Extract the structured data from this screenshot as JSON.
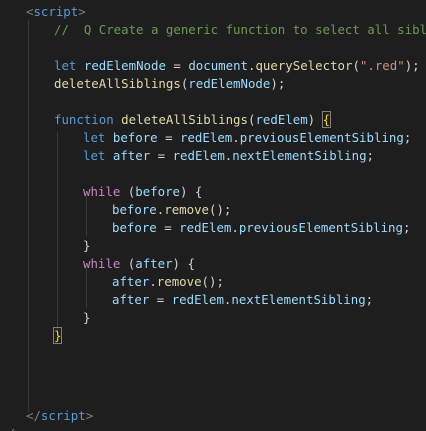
{
  "editor": {
    "language": "javascript",
    "colors": {
      "background": "#1e1e1e",
      "keyword": "#569cd6",
      "control": "#c586c0",
      "variable": "#9cdcfe",
      "function": "#dcdcaa",
      "string": "#ce9178",
      "comment": "#6a9955",
      "tag": "#808080",
      "brace": "#ffd700"
    },
    "tokens": {
      "script_open_lt": "<",
      "script_open_name": "script",
      "script_open_gt": ">",
      "comment": "//  Q Create a generic function to select all siblin",
      "kw_let_1": "let",
      "var_redElemNode": "redElemNode",
      "eq_1": " = ",
      "var_document": "document",
      "dot_1": ".",
      "fn_querySelector": "querySelector",
      "paren_open_1": "(",
      "str_red": "\".red\"",
      "paren_close_semi_1": ");",
      "fn_deleteAllSiblings_call": "deleteAllSiblings",
      "paren_open_2": "(",
      "var_redElemNode_2": "redElemNode",
      "paren_close_semi_2": ");",
      "kw_function": "function",
      "fn_deleteAllSiblings_decl": "deleteAllSiblings",
      "paren_open_3": "(",
      "param_redElem": "redElem",
      "paren_close_3": ")",
      "brace_open_fn": "{",
      "kw_let_2": "let",
      "var_before": "before",
      "eq_2": " = ",
      "var_redElem_1": "redElem",
      "dot_2": ".",
      "var_previousElementSibling_1": "previousElementSibling",
      "semi_1": ";",
      "kw_let_3": "let",
      "var_after": "after",
      "eq_3": " = ",
      "var_redElem_2": "redElem",
      "dot_3": ".",
      "var_nextElementSibling_1": "nextElementSibling",
      "semi_2": ";",
      "kw_while_1": "while",
      "paren_open_4": " (",
      "var_before_2": "before",
      "paren_close_brace_1": ") {",
      "var_before_3": "before",
      "dot_4": ".",
      "fn_remove_1": "remove",
      "call_semi_1": "();",
      "var_before_4": "before",
      "eq_4": " = ",
      "var_redElem_3": "redElem",
      "dot_5": ".",
      "var_previousElementSibling_2": "previousElementSibling",
      "semi_3": ";",
      "brace_close_1": "}",
      "kw_while_2": "while",
      "paren_open_5": " (",
      "var_after_2": "after",
      "paren_close_brace_2": ") {",
      "var_after_3": "after",
      "dot_6": ".",
      "fn_remove_2": "remove",
      "call_semi_2": "();",
      "var_after_4": "after",
      "eq_5": " = ",
      "var_redElem_4": "redElem",
      "dot_7": ".",
      "var_nextElementSibling_2": "nextElementSibling",
      "semi_4": ";",
      "brace_close_2": "}",
      "brace_close_fn": "}",
      "script_close_lt": "</",
      "script_close_name": "script",
      "script_close_gt": ">",
      "partial_bottom": "</"
    }
  }
}
